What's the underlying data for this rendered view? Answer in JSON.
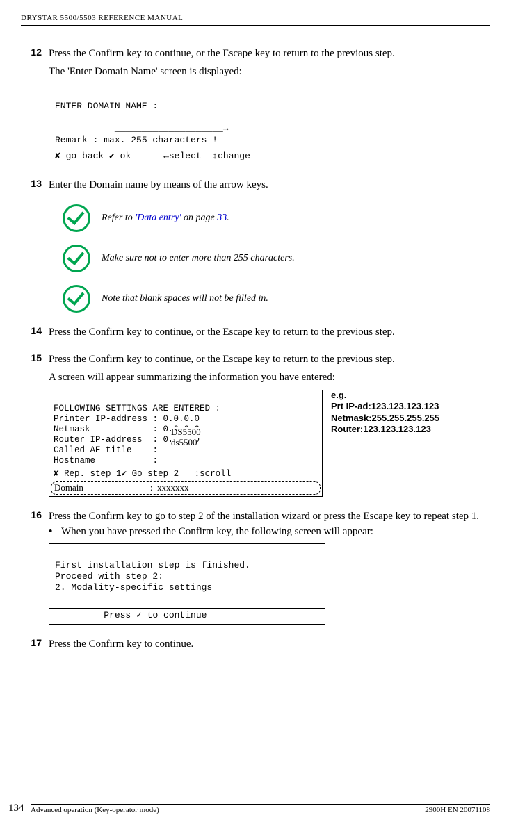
{
  "header": "DRYSTAR 5500/5503 REFERENCE MANUAL",
  "steps": {
    "s12": {
      "num": "12",
      "text": "Press the Confirm key to continue, or the Escape key to return to the previous step."
    },
    "s12_sub": "The 'Enter Domain Name' screen is displayed:",
    "screen1": {
      "l1": "ENTER DOMAIN NAME :",
      "l2": "",
      "l3": "           ____________________→",
      "l4": "Remark : max. 255 characters !",
      "softkeys": "✘ go back ✔ ok      ↔select  ↕change"
    },
    "s13": {
      "num": "13",
      "text": "Enter the Domain name by means of the arrow keys."
    },
    "note1_a": "Refer to ",
    "note1_b": "'Data entry'",
    "note1_c": " on page ",
    "note1_d": "33",
    "note1_e": ".",
    "note2": "Make sure not to enter more than 255 characters.",
    "note3": "Note that blank spaces will not be filled in.",
    "s14": {
      "num": "14",
      "text": "Press the Confirm key to continue, or the Escape key to return to the previous step."
    },
    "s15": {
      "num": "15",
      "text": "Press the Confirm key to continue, or the Escape key to return to the previous step."
    },
    "s15_sub": "A screen will appear summarizing the information you have entered:",
    "screen2": {
      "l1": "FOLLOWING SETTINGS ARE ENTERED :",
      "l2": "Printer IP-address : 0.0.0.0",
      "l3": "Netmask            : 0.0.0.0",
      "l4": "Router IP-address  : 0.0.0.0",
      "l5": "Called AE-title    : ",
      "l5_over": "DS5500",
      "l6": "Hostname           : ",
      "l6_over": "ds5500",
      "soft": "✘ Rep. step 1✔ Go step 2   ↕scroll",
      "domain_a": "Domain",
      "domain_b": ":  xxxxxxx"
    },
    "eg": {
      "l1": "e.g.",
      "l2": "Prt IP-ad:123.123.123.123",
      "l3": "Netmask:255.255.255.255",
      "l4": "Router:123.123.123.123"
    },
    "s16": {
      "num": "16",
      "text": "Press the Confirm key to go to step 2 of the installation wizard or press the Escape key to repeat step 1."
    },
    "s16_bullet": "When you have pressed the Confirm key, the following screen will appear:",
    "screen3": {
      "l1": "First installation step is finished.",
      "l2": "Proceed with step 2:",
      "l3": "2. Modality-specific settings",
      "l4": "",
      "l5": "         Press ✓ to continue"
    },
    "s17": {
      "num": "17",
      "text": "Press the Confirm key to continue."
    }
  },
  "footer": {
    "page": "134",
    "left": "Advanced operation (Key-operator mode)",
    "right": "2900H EN 20071108"
  }
}
